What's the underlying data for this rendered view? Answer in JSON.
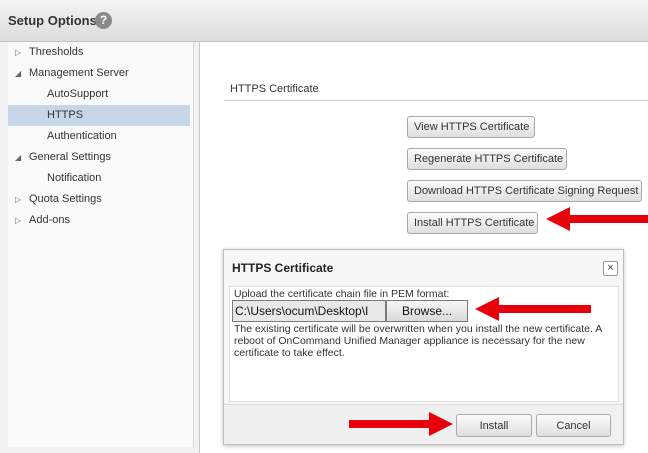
{
  "header": {
    "title": "Setup Options",
    "help_icon": "?"
  },
  "sidebar": {
    "items": [
      {
        "label": "Thresholds",
        "expanded": false,
        "level": 0
      },
      {
        "label": "Management Server",
        "expanded": true,
        "level": 0
      },
      {
        "label": "AutoSupport",
        "level": 1
      },
      {
        "label": "HTTPS",
        "level": 1,
        "selected": true
      },
      {
        "label": "Authentication",
        "level": 1
      },
      {
        "label": "General Settings",
        "expanded": true,
        "level": 0
      },
      {
        "label": "Notification",
        "level": 1
      },
      {
        "label": "Quota Settings",
        "expanded": false,
        "level": 0
      },
      {
        "label": "Add-ons",
        "expanded": false,
        "level": 0
      }
    ]
  },
  "main": {
    "section_title": "HTTPS Certificate",
    "buttons": {
      "view": "View HTTPS Certificate",
      "regenerate": "Regenerate HTTPS Certificate",
      "download_csr": "Download HTTPS Certificate Signing Request",
      "install": "Install HTTPS Certificate"
    }
  },
  "dialog": {
    "title": "HTTPS Certificate",
    "close": "×",
    "upload_label": "Upload the certificate chain file in PEM format:",
    "file_value": "C:\\Users\\ocum\\Desktop\\I",
    "browse_label": "Browse...",
    "notice": "The existing certificate will be overwritten when you install the new certificate. A reboot of OnCommand Unified Manager appliance is necessary for the new certificate to take effect.",
    "install_label": "Install",
    "cancel_label": "Cancel"
  },
  "colors": {
    "annotation_arrow": "#e8000b",
    "selected_item": "#c7d6e8"
  }
}
